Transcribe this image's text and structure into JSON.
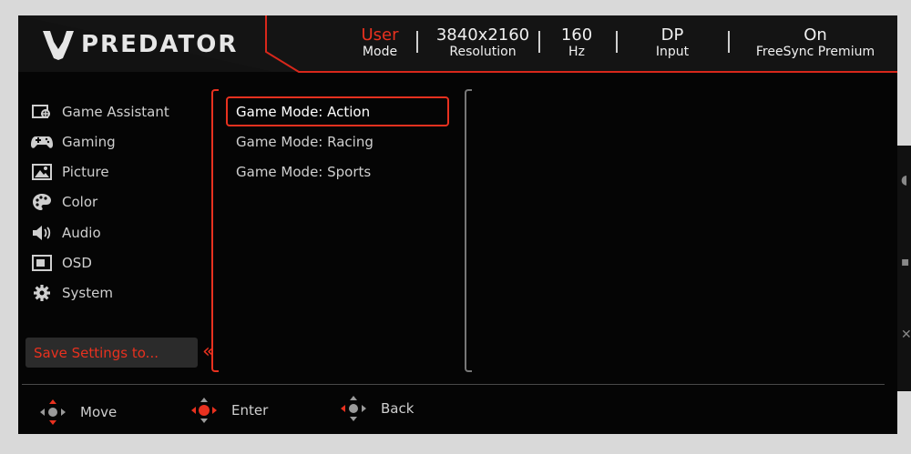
{
  "brand": {
    "logo_text": "PREDATOR"
  },
  "status_bar": [
    {
      "value": "User",
      "label": "Mode",
      "highlight": true
    },
    {
      "value": "3840x2160",
      "label": "Resolution",
      "highlight": false
    },
    {
      "value": "160",
      "label": "Hz",
      "highlight": false
    },
    {
      "value": "DP",
      "label": "Input",
      "highlight": false
    },
    {
      "value": "On",
      "label": "FreeSync Premium",
      "highlight": false
    }
  ],
  "sidebar": {
    "items": [
      {
        "label": "Game Assistant",
        "icon": "game-assistant-icon"
      },
      {
        "label": "Gaming",
        "icon": "gamepad-icon"
      },
      {
        "label": "Picture",
        "icon": "picture-icon"
      },
      {
        "label": "Color",
        "icon": "palette-icon"
      },
      {
        "label": "Audio",
        "icon": "speaker-icon"
      },
      {
        "label": "OSD",
        "icon": "osd-icon"
      },
      {
        "label": "System",
        "icon": "gear-icon"
      }
    ],
    "save_settings": "Save Settings to..."
  },
  "submenu": {
    "items": [
      {
        "label": "Game Mode: Action",
        "selected": true
      },
      {
        "label": "Game Mode: Racing",
        "selected": false
      },
      {
        "label": "Game Mode: Sports",
        "selected": false
      }
    ]
  },
  "footer": {
    "move": "Move",
    "enter": "Enter",
    "back": "Back"
  },
  "colors": {
    "accent": "#e8311f",
    "background": "#050505",
    "text": "#cfcfcf"
  }
}
